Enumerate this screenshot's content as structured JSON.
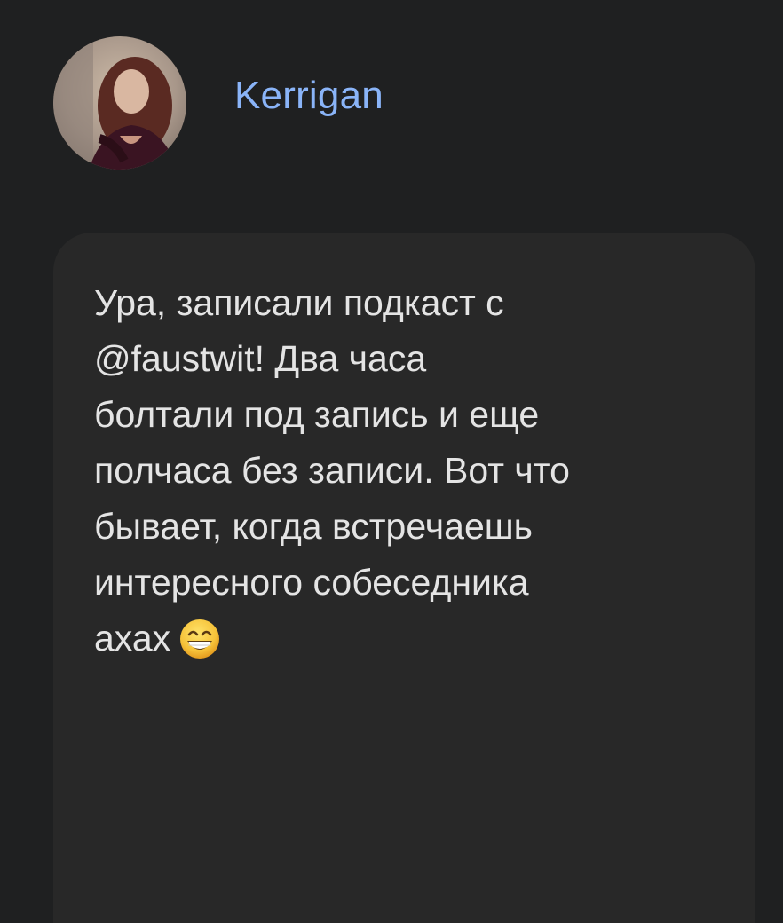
{
  "author": {
    "name": "Kerrigan",
    "avatar": "user-avatar-photo",
    "name_color": "#8ab4f8"
  },
  "message": {
    "lines": [
      "Ура, записали подкаст с",
      "@faustwit! Два часа",
      "болтали под запись и еще",
      "полчаса без записи. Вот что",
      "бывает, когда встречаешь",
      "интересного собеседника",
      "ахах"
    ],
    "emoji": "grinning-face-with-smiling-eyes-emoji"
  },
  "colors": {
    "background": "#1f2021",
    "bubble": "#282828",
    "text": "#e4e4e4"
  }
}
